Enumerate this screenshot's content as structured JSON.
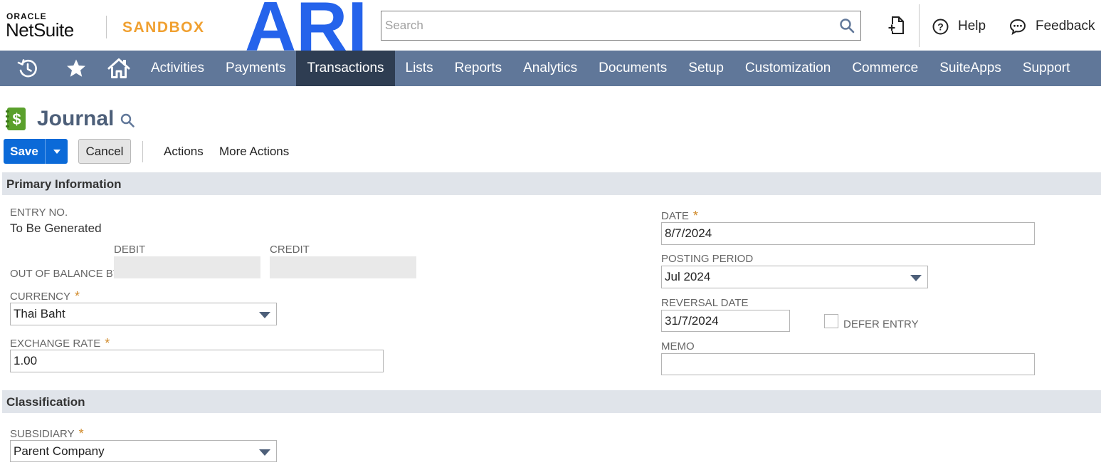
{
  "header": {
    "oracle_label": "ORACLE",
    "netsuite_label": "NetSuite",
    "sandbox_label": "SANDBOX",
    "logo_text": "ARI",
    "logo_color": "#2563eb",
    "search_placeholder": "Search",
    "help_label": "Help",
    "feedback_label": "Feedback"
  },
  "nav": {
    "items": [
      "Activities",
      "Payments",
      "Transactions",
      "Lists",
      "Reports",
      "Analytics",
      "Documents",
      "Setup",
      "Customization",
      "Commerce",
      "SuiteApps",
      "Support"
    ],
    "active": "Transactions",
    "bg_color": "#607799",
    "active_color": "#2e3d52"
  },
  "page": {
    "title": "Journal"
  },
  "buttons": {
    "save": "Save",
    "cancel": "Cancel",
    "actions": "Actions",
    "more_actions": "More Actions"
  },
  "primary": {
    "section_title": "Primary Information",
    "entry_no_label": "ENTRY NO.",
    "entry_no_value": "To Be Generated",
    "debit_label": "DEBIT",
    "credit_label": "CREDIT",
    "out_of_balance_label": "OUT OF BALANCE BY",
    "currency_label": "CURRENCY",
    "currency_value": "Thai Baht",
    "exchange_rate_label": "EXCHANGE RATE",
    "exchange_rate_value": "1.00",
    "date_label": "DATE",
    "date_value": "8/7/2024",
    "posting_period_label": "POSTING PERIOD",
    "posting_period_value": "Jul 2024",
    "reversal_date_label": "REVERSAL DATE",
    "reversal_date_value": "31/7/2024",
    "defer_entry_label": "DEFER ENTRY",
    "memo_label": "MEMO",
    "memo_value": ""
  },
  "classification": {
    "section_title": "Classification",
    "subsidiary_label": "SUBSIDIARY",
    "subsidiary_value": "Parent Company"
  }
}
